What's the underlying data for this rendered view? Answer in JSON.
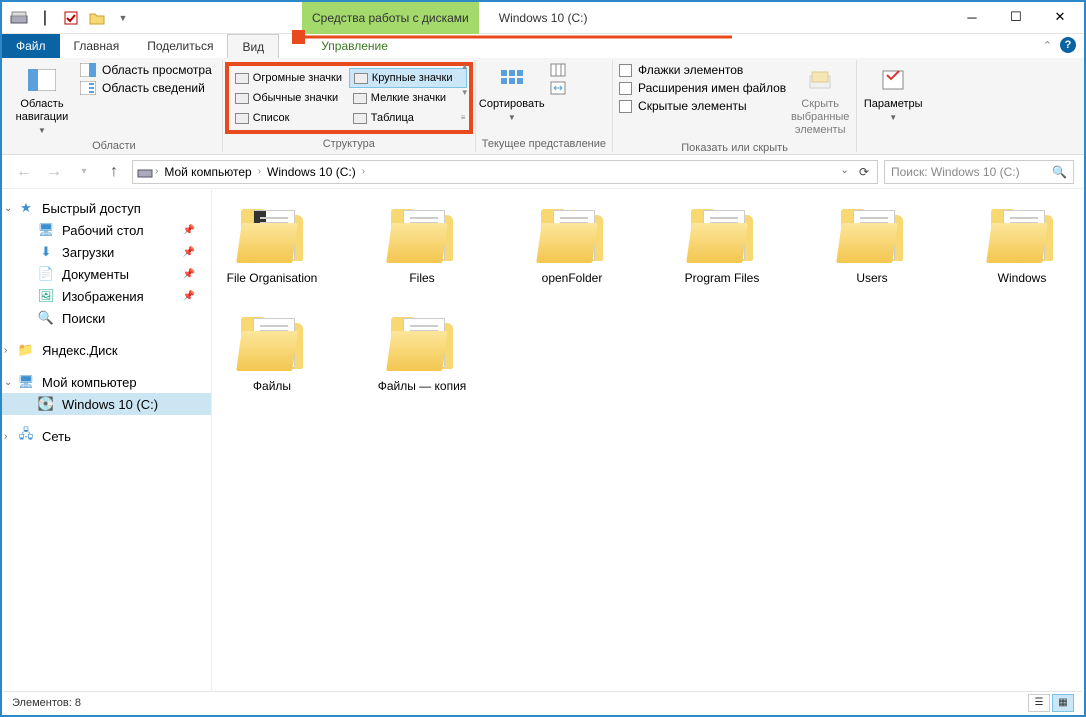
{
  "titlebar": {
    "contextual_label": "Средства работы с дисками",
    "window_title": "Windows 10 (C:)"
  },
  "tabs": {
    "file": "Файл",
    "home": "Главная",
    "share": "Поделиться",
    "view": "Вид",
    "manage": "Управление"
  },
  "ribbon": {
    "panes": {
      "label": "Области",
      "nav_pane": "Область навигации",
      "preview_pane": "Область просмотра",
      "details_pane": "Область сведений"
    },
    "layout": {
      "label": "Структура",
      "huge": "Огромные значки",
      "large": "Крупные значки",
      "normal": "Обычные значки",
      "small": "Мелкие значки",
      "list": "Список",
      "table": "Таблица"
    },
    "current_view": {
      "label": "Текущее представление",
      "sort": "Сортировать"
    },
    "show_hide": {
      "label": "Показать или скрыть",
      "checkboxes": "Флажки элементов",
      "extensions": "Расширения имен файлов",
      "hidden": "Скрытые элементы",
      "hide_selected": "Скрыть выбранные элементы"
    },
    "options": {
      "label": "Параметры"
    }
  },
  "breadcrumbs": {
    "my_computer": "Мой компьютер",
    "drive": "Windows 10 (C:)"
  },
  "search": {
    "placeholder": "Поиск: Windows 10 (C:)"
  },
  "sidebar": {
    "quick_access": "Быстрый доступ",
    "desktop": "Рабочий стол",
    "downloads": "Загрузки",
    "documents": "Документы",
    "pictures": "Изображения",
    "searches": "Поиски",
    "yandex_disk": "Яндекс.Диск",
    "my_computer": "Мой компьютер",
    "drive_c": "Windows 10 (C:)",
    "network": "Сеть"
  },
  "folders": [
    "File Organisation",
    "Files",
    "openFolder",
    "Program Files",
    "Users",
    "Windows",
    "Файлы",
    "Файлы — копия"
  ],
  "statusbar": {
    "items": "Элементов: 8"
  }
}
